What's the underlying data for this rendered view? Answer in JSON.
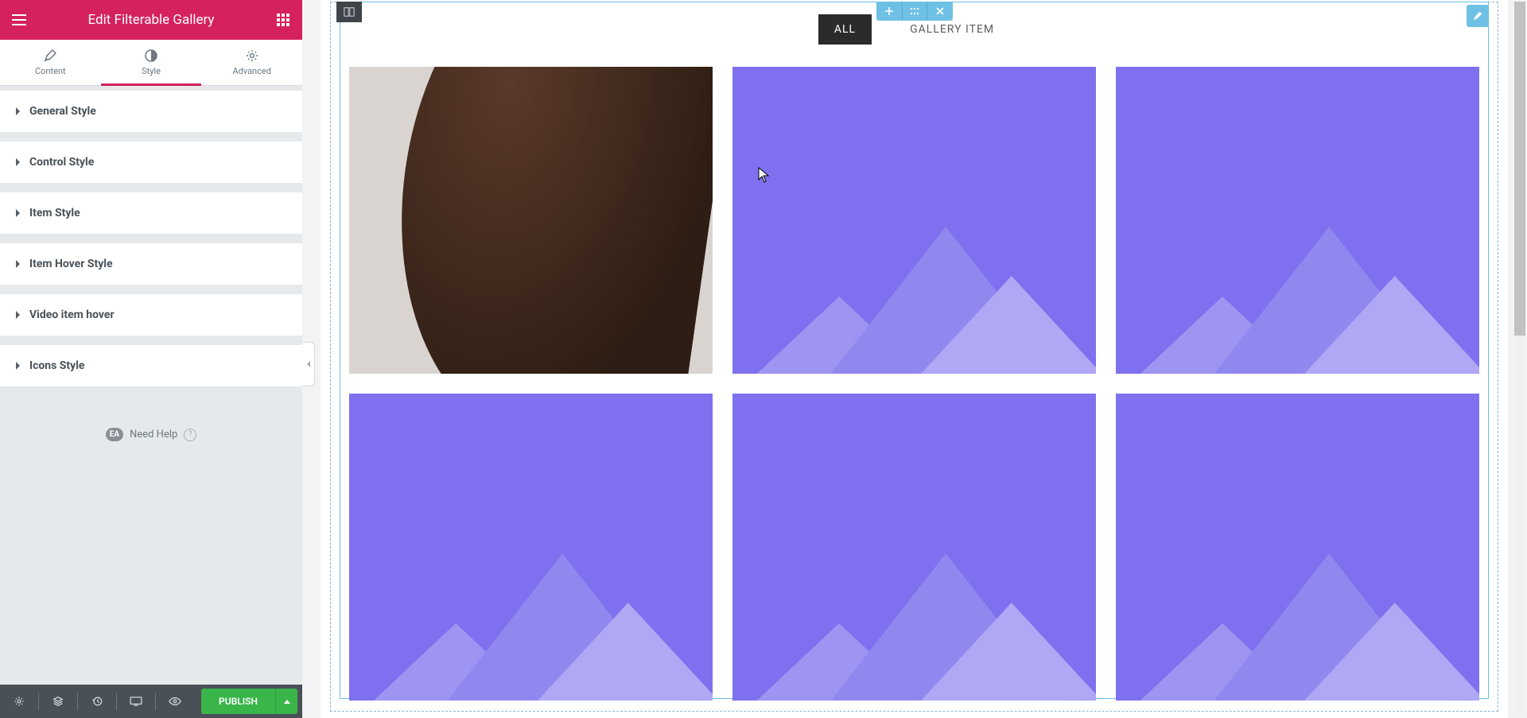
{
  "header": {
    "title": "Edit Filterable Gallery"
  },
  "tabs": {
    "content": "Content",
    "style": "Style",
    "advanced": "Advanced"
  },
  "sections": [
    {
      "label": "General Style"
    },
    {
      "label": "Control Style"
    },
    {
      "label": "Item Style"
    },
    {
      "label": "Item Hover Style"
    },
    {
      "label": "Video item hover"
    },
    {
      "label": "Icons Style"
    }
  ],
  "help": {
    "badge": "EA",
    "label": "Need Help",
    "q": "?"
  },
  "footer": {
    "publish": "PUBLISH"
  },
  "filters": {
    "all": "ALL",
    "item": "GALLERY ITEM"
  }
}
